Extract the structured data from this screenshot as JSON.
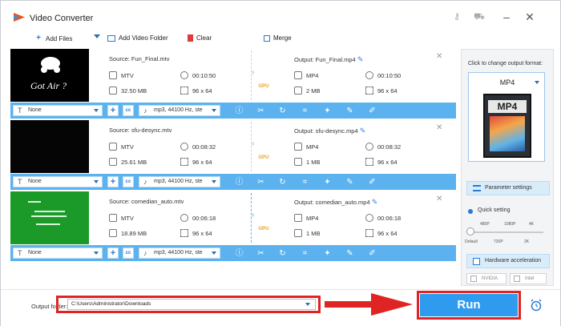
{
  "app": {
    "title": "Video Converter",
    "brand_color": "#2f9bef"
  },
  "toolbar": {
    "add_files": "Add Files",
    "add_video_folder": "Add Video Folder",
    "clear": "Clear",
    "merge": "Merge"
  },
  "items": [
    {
      "source": "Source: Fun_Final.mtv",
      "output": "Output: Fun_Final.mp4",
      "src_format": "MTV",
      "src_duration": "00:10:50",
      "src_size": "32.50 MB",
      "src_res": "96 x 64",
      "out_format": "MP4",
      "out_duration": "00:10:50",
      "out_size": "2 MB",
      "out_res": "96 x 64",
      "gpu": "GPU",
      "subtitle": "None",
      "audio": "mp3, 44100 Hz, ste",
      "thumb_text": "Got Air ?"
    },
    {
      "source": "Source: sfu-desync.mtv",
      "output": "Output: sfu-desync.mp4",
      "src_format": "MTV",
      "src_duration": "00:08:32",
      "src_size": "25.61 MB",
      "src_res": "96 x 64",
      "out_format": "MP4",
      "out_duration": "00:08:32",
      "out_size": "1 MB",
      "out_res": "96 x 64",
      "gpu": "GPU",
      "subtitle": "None",
      "audio": "mp3, 44100 Hz, ste"
    },
    {
      "source": "Source: comedian_auto.mtv",
      "output": "Output: comedian_auto.mp4",
      "src_format": "MTV",
      "src_duration": "00:06:18",
      "src_size": "18.89 MB",
      "src_res": "96 x 64",
      "out_format": "MP4",
      "out_duration": "00:06:18",
      "out_size": "1 MB",
      "out_res": "96 x 64",
      "gpu": "GPU",
      "subtitle": "None",
      "audio": "mp3, 44100 Hz, ste"
    }
  ],
  "panel": {
    "click_label": "Click to change output format:",
    "format": "MP4",
    "format_icon_text": "MP4",
    "parameter_settings": "Parameter settings",
    "quick_setting": "Quick setting",
    "qs_top": [
      "480P",
      "1080P",
      "4K"
    ],
    "qs_bottom": [
      "Default",
      "720P",
      "2K"
    ],
    "qs_level": "Default",
    "hardware_acceleration": "Hardware acceleration",
    "nvidia": "NVIDIA",
    "intel": "Intel"
  },
  "bottom": {
    "output_folder_label": "Output folder:",
    "output_folder_value": "C:\\Users\\Administrator\\Downloads",
    "run": "Run"
  }
}
